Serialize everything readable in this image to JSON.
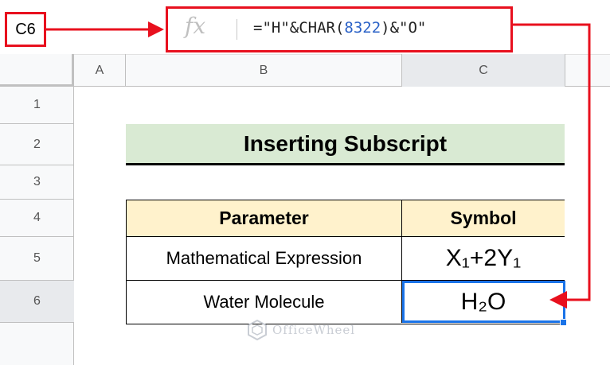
{
  "name_box": "C6",
  "formula_bar": {
    "fx_label": "fx",
    "formula_part1": "=\"H\"&CHAR(",
    "formula_number": "8322",
    "formula_part2": ")&\"O\""
  },
  "columns": [
    "A",
    "B",
    "C"
  ],
  "rows": [
    "1",
    "2",
    "3",
    "4",
    "5",
    "6"
  ],
  "sheet": {
    "title": "Inserting Subscript",
    "table": {
      "headers": [
        "Parameter",
        "Symbol"
      ],
      "rows": [
        {
          "parameter": "Mathematical Expression",
          "symbol": "X₁+2Y₁"
        },
        {
          "parameter": "Water Molecule",
          "symbol": "H₂O"
        }
      ]
    }
  },
  "watermark": "OfficeWheel",
  "colors": {
    "annotation_red": "#e8101e",
    "selection_blue": "#1a73e8",
    "title_fill": "#d9ead3",
    "header_fill": "#fff2cc"
  },
  "icons": {
    "formula": "fx-icon",
    "watermark_logo": "officewheel-logo-icon"
  }
}
